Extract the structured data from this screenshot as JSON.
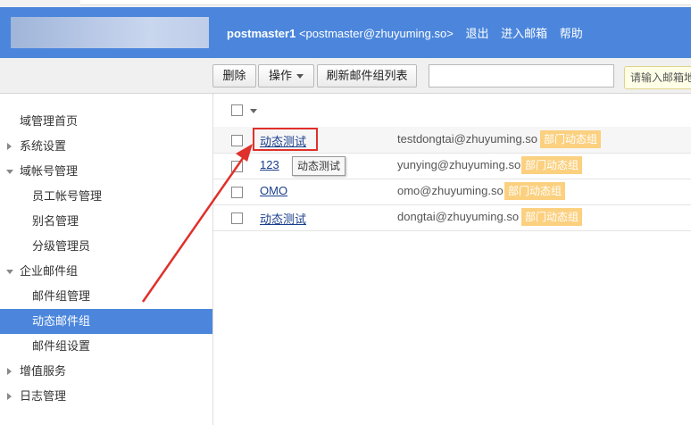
{
  "header": {
    "username": "postmaster1",
    "email": "<postmaster@zhuyuming.so>",
    "links": [
      "退出",
      "进入邮箱",
      "帮助"
    ]
  },
  "toolbar": {
    "delete_label": "删除",
    "operate_label": "操作",
    "refresh_label": "刷新邮件组列表",
    "search_value": "",
    "search_hint": "请输入邮箱地址"
  },
  "sidebar": {
    "items": [
      {
        "label": "域管理首页"
      },
      {
        "label": "系统设置"
      },
      {
        "label": "域帐号管理"
      },
      {
        "label": "员工帐号管理"
      },
      {
        "label": "别名管理"
      },
      {
        "label": "分级管理员"
      },
      {
        "label": "企业邮件组"
      },
      {
        "label": "邮件组管理"
      },
      {
        "label": "动态邮件组"
      },
      {
        "label": "邮件组设置"
      },
      {
        "label": "增值服务"
      },
      {
        "label": "日志管理"
      }
    ]
  },
  "list": {
    "rows": [
      {
        "name": "动态测试",
        "email": "testdongtai@zhuyuming.so",
        "tag": "部门动态组"
      },
      {
        "name": "123",
        "email": "yunying@zhuyuming.so",
        "tag": "部门动态组"
      },
      {
        "name": "OMO",
        "email": "omo@zhuyuming.so",
        "tag": "部门动态组"
      },
      {
        "name": "动态测试",
        "email": "dongtai@zhuyuming.so",
        "tag": "部门动态组"
      }
    ]
  },
  "tooltip": "动态测试",
  "colors": {
    "header": "#4b86dc",
    "active_nav": "#4b86dc",
    "badge": "#fbd07f",
    "annotation": "#e0302b"
  }
}
